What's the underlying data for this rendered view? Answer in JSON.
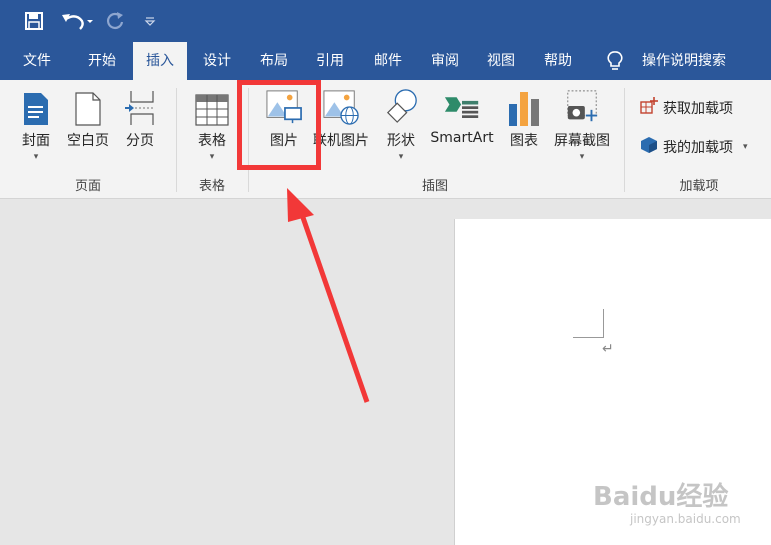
{
  "quick_access": {
    "save_icon": "save-icon",
    "undo_icon": "undo-icon",
    "redo_icon": "redo-icon",
    "customize_icon": "customize-qat-icon"
  },
  "tabs": [
    "文件",
    "开始",
    "插入",
    "设计",
    "布局",
    "引用",
    "邮件",
    "审阅",
    "视图",
    "帮助"
  ],
  "active_tab": "插入",
  "tell_me": "操作说明搜索",
  "ribbon": {
    "pages": {
      "cover": "封面",
      "blank": "空白页",
      "break": "分页",
      "group": "页面"
    },
    "tables": {
      "table": "表格",
      "group": "表格"
    },
    "illustrations": {
      "picture": "图片",
      "online_picture": "联机图片",
      "shapes": "形状",
      "smartart": "SmartArt",
      "chart": "图表",
      "screenshot": "屏幕截图",
      "group": "插图"
    },
    "addins": {
      "get": "获取加载项",
      "mine": "我的加载项",
      "group": "加载项"
    }
  },
  "document": {
    "paragraph_mark": "↵"
  },
  "watermark": {
    "brand": "Baidu经验",
    "url": "jingyan.baidu.com"
  },
  "colors": {
    "title_blue": "#2b579a",
    "highlight_red": "#f23838",
    "ribbon_bg": "#f3f3f3"
  }
}
